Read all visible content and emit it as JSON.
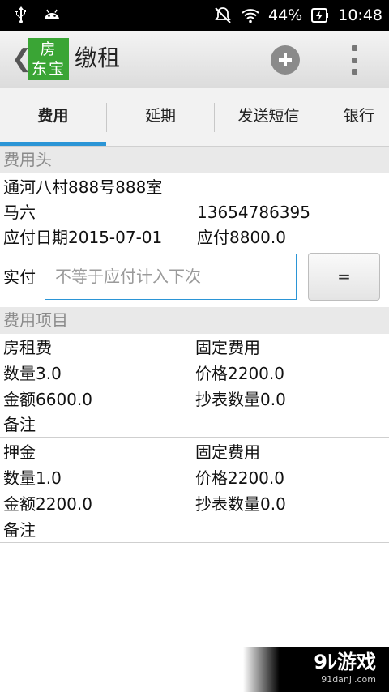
{
  "status_bar": {
    "battery": "44%",
    "time": "10:48",
    "icons": [
      "usb-icon",
      "android-debug-icon",
      "mute-icon",
      "wifi-icon",
      "battery-charging-icon"
    ]
  },
  "action_bar": {
    "logo_line1": "房",
    "logo_line2": "东宝",
    "title": "缴租",
    "accent_color": "#3aa535"
  },
  "tabs": [
    {
      "label": "费用",
      "selected": true
    },
    {
      "label": "延期",
      "selected": false
    },
    {
      "label": "发送短信",
      "selected": false
    },
    {
      "label": "银行账",
      "selected": false
    }
  ],
  "fee_header": {
    "section_title": "费用头",
    "address": "通河八村888号888室",
    "tenant_name": "马六",
    "phone": "13654786395",
    "due_date": "应付日期2015-07-01",
    "amount_due": "应付8800.0",
    "paid_label": "实付",
    "paid_placeholder": "不等于应付计入下次",
    "equals_button": "="
  },
  "fee_items_section": "费用项目",
  "fee_items": [
    {
      "name": "房租费",
      "type": "固定费用",
      "quantity": "数量3.0",
      "price": "价格2200.0",
      "amount": "金额6600.0",
      "meter": "抄表数量0.0",
      "note": "备注"
    },
    {
      "name": "押金",
      "type": "固定费用",
      "quantity": "数量1.0",
      "price": "价格2200.0",
      "amount": "金额2200.0",
      "meter": "抄表数量0.0",
      "note": "备注"
    }
  ],
  "watermark": {
    "brand": "9ﾚ游戏",
    "site": "91danji.com"
  },
  "colors": {
    "tab_indicator": "#2b95d6",
    "input_border": "#2b95d6"
  }
}
